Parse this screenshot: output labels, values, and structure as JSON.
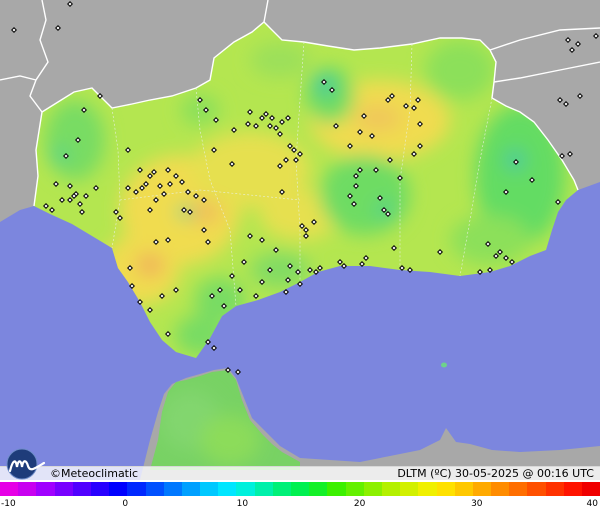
{
  "branding": {
    "name": "Meteoclimatic",
    "copyright_symbol": "©"
  },
  "caption": {
    "text": "DLTM (ºC)  30-05-2025 @ 00:16 UTC"
  },
  "scale": {
    "ticks": [
      "-10",
      "0",
      "10",
      "20",
      "30",
      "40"
    ],
    "min": -10,
    "max": 40,
    "colors": [
      "#e600e6",
      "#c800f0",
      "#a000ff",
      "#7800ff",
      "#5000ff",
      "#2800ff",
      "#0000ff",
      "#0028ff",
      "#0050ff",
      "#0078ff",
      "#00a0ff",
      "#00c8ff",
      "#00e6ff",
      "#00f0dc",
      "#00f0aa",
      "#00f078",
      "#00f050",
      "#14f028",
      "#3cf000",
      "#64f000",
      "#8cf000",
      "#b4f000",
      "#d2f000",
      "#f0f000",
      "#ffe100",
      "#ffc800",
      "#ffaa00",
      "#ff8c00",
      "#ff6e00",
      "#ff5000",
      "#ff3200",
      "#ff1400",
      "#f00000"
    ]
  },
  "map": {
    "colors": {
      "sea": "#7c86de",
      "land_outside": "#a8a8a8",
      "land_base": "#b4e650",
      "warm": "#f0dc50",
      "hot": "#f0b45a",
      "cool": "#64dc64",
      "cold": "#3cc8a0",
      "border": "#ffffff",
      "station": "#000000"
    }
  }
}
